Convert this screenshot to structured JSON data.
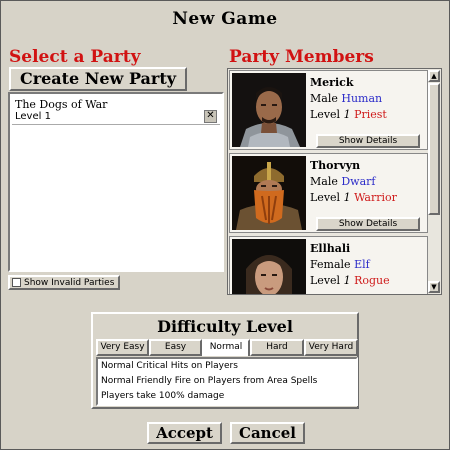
{
  "window_title": "New Game",
  "select_party": {
    "heading": "Select a Party",
    "create_label": "Create New Party",
    "parties": [
      {
        "name": "The Dogs of War",
        "level": "Level 1"
      }
    ],
    "delete_glyph": "✕",
    "show_invalid_label": "Show Invalid Parties",
    "show_invalid_checked": false
  },
  "party_members": {
    "heading": "Party Members",
    "show_details_label": "Show Details",
    "members": [
      {
        "name": "Merick",
        "gender": "Male",
        "race": "Human",
        "level_word": "Level",
        "level_num": "1",
        "class": "Priest"
      },
      {
        "name": "Thorvyn",
        "gender": "Male",
        "race": "Dwarf",
        "level_word": "Level",
        "level_num": "1",
        "class": "Warrior"
      },
      {
        "name": "Ellhali",
        "gender": "Female",
        "race": "Elf",
        "level_word": "Level",
        "level_num": "1",
        "class": "Rogue"
      }
    ],
    "scroll_up_glyph": "▲",
    "scroll_down_glyph": "▼"
  },
  "difficulty": {
    "heading": "Difficulty Level",
    "tabs": [
      "Very Easy",
      "Easy",
      "Normal",
      "Hard",
      "Very Hard"
    ],
    "selected": "Normal",
    "lines": [
      "Normal Critical Hits on Players",
      "Normal Friendly Fire on Players from Area Spells",
      "Players take 100% damage"
    ]
  },
  "buttons": {
    "accept": "Accept",
    "cancel": "Cancel"
  },
  "colors": {
    "heading_red": "#d11212",
    "race_blue": "#2d2dc9",
    "class_red": "#cf1b1b",
    "panel_bg": "#d7d3c8"
  }
}
